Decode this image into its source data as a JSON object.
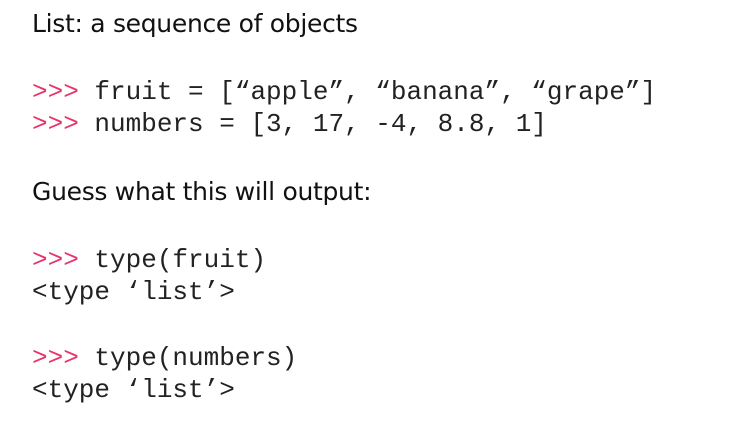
{
  "title": "List: a sequence of objects",
  "prompt": ">>>",
  "assignments": [
    {
      "code": "fruit = [“apple”, “banana”, “grape”]"
    },
    {
      "code": "numbers = [3, 17, -4, 8.8, 1]"
    }
  ],
  "question": "Guess what this will output:",
  "examples": [
    {
      "command": "type(fruit)",
      "output": "<type ‘list’>"
    },
    {
      "command": "type(numbers)",
      "output": "<type ‘list’>"
    }
  ],
  "colors": {
    "prompt": "#e8336b",
    "text": "#111111",
    "code": "#222222",
    "background": "#ffffff"
  }
}
